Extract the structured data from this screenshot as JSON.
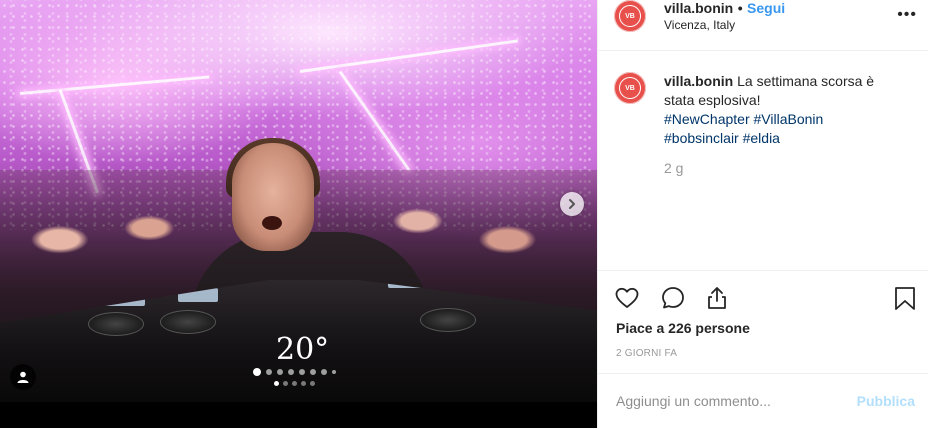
{
  "post": {
    "username": "villa.bonin",
    "follow_separator": "•",
    "follow_label": "Segui",
    "location": "Vicenza, Italy",
    "more_label": "•••",
    "avatar_initials": "VB",
    "caption_user": "villa.bonin",
    "caption_text": "La settimana scorsa è stata esplosiva!",
    "hashtags_line1": "#NewChapter #VillaBonin",
    "hashtags_line2": "#bobsinclair #eldia",
    "time_ago": "2 g",
    "likes_text": "Piace a 226 persone",
    "date_text": "2 GIORNI FA",
    "comment_placeholder": "Aggiungi un commento...",
    "publish_label": "Pubblica"
  },
  "media": {
    "overlay_logo": "20°",
    "carousel_dots_primary": 8,
    "carousel_active_index": 0,
    "carousel_dots_secondary": 5,
    "carousel_secondary_active_index": 0
  },
  "icons": {
    "like": "heart-icon",
    "comment": "comment-icon",
    "share": "share-icon",
    "save": "bookmark-icon",
    "next": "chevron-right-icon",
    "user_tags": "user-icon"
  },
  "colors": {
    "brand_avatar": "#e8504c",
    "link_blue": "#3897f0",
    "hashtag_blue": "#003569",
    "publish_disabled": "#b2dffc"
  }
}
